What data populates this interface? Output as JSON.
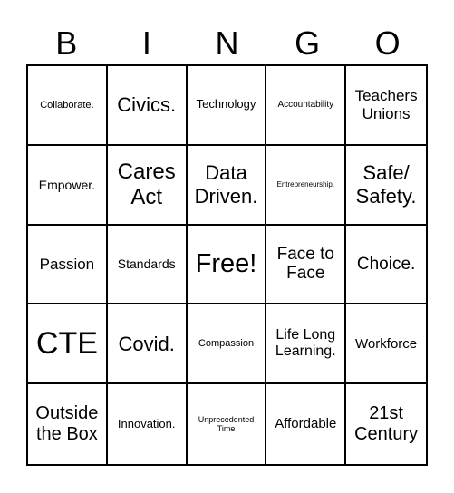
{
  "header": {
    "letters": [
      "B",
      "I",
      "N",
      "G",
      "O"
    ]
  },
  "cells": [
    [
      "Collaborate.",
      "Civics.",
      "Technology",
      "Accountability",
      "Teachers Unions"
    ],
    [
      "Empower.",
      "Cares Act",
      "Data Driven.",
      "Entrepreneurship.",
      "Safe/ Safety."
    ],
    [
      "Passion",
      "Standards",
      "Free!",
      "Face to Face",
      "Choice."
    ],
    [
      "CTE",
      "Covid.",
      "Compassion",
      "Life Long Learning.",
      "Workforce"
    ],
    [
      "Outside the Box",
      "Innovation.",
      "Unprecedented Time",
      "Affordable",
      "21st Century"
    ]
  ]
}
